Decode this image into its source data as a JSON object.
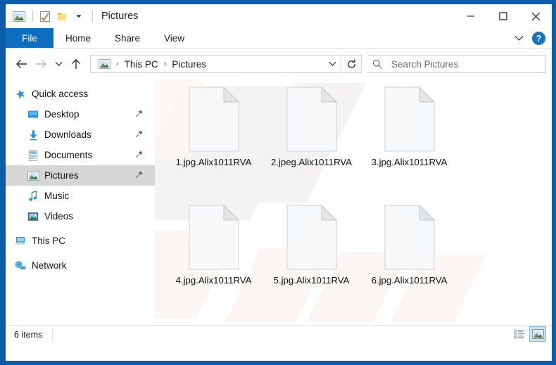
{
  "window": {
    "title": "Pictures",
    "accent_color": "#0d5ca9",
    "quick_access_icons": [
      "pictures-icon",
      "checkmark-document-icon",
      "folder-icon",
      "chevron-down-icon"
    ],
    "controls": {
      "minimize": "─",
      "maximize": "☐",
      "close": "✕"
    }
  },
  "ribbon": {
    "tabs": [
      {
        "label": "File",
        "active": true
      },
      {
        "label": "Home",
        "active": false
      },
      {
        "label": "Share",
        "active": false
      },
      {
        "label": "View",
        "active": false
      }
    ],
    "expand_icon": "chevron-down-icon",
    "help_label": "?"
  },
  "navigation": {
    "back_title": "Back",
    "forward_title": "Forward",
    "recent_title": "Recent locations",
    "up_title": "Up",
    "breadcrumb": [
      "This PC",
      "Pictures"
    ],
    "breadcrumb_separator": "›",
    "refresh_title": "Refresh"
  },
  "search": {
    "placeholder": "Search Pictures",
    "value": ""
  },
  "sidebar": {
    "items": [
      {
        "label": "Quick access",
        "icon": "star-icon",
        "root": true,
        "pinned": false,
        "selected": false
      },
      {
        "label": "Desktop",
        "icon": "desktop-icon",
        "root": false,
        "pinned": true,
        "selected": false
      },
      {
        "label": "Downloads",
        "icon": "downloads-icon",
        "root": false,
        "pinned": true,
        "selected": false
      },
      {
        "label": "Documents",
        "icon": "documents-icon",
        "root": false,
        "pinned": true,
        "selected": false
      },
      {
        "label": "Pictures",
        "icon": "pictures-icon",
        "root": false,
        "pinned": true,
        "selected": true
      },
      {
        "label": "Music",
        "icon": "music-icon",
        "root": false,
        "pinned": false,
        "selected": false
      },
      {
        "label": "Videos",
        "icon": "videos-icon",
        "root": false,
        "pinned": false,
        "selected": false
      },
      {
        "label": "This PC",
        "icon": "this-pc-icon",
        "root": true,
        "pinned": false,
        "selected": false
      },
      {
        "label": "Network",
        "icon": "network-icon",
        "root": true,
        "pinned": false,
        "selected": false
      }
    ]
  },
  "files": [
    {
      "name": "1.jpg.Alix1011RVA",
      "icon": "blank-file-icon"
    },
    {
      "name": "2.jpeg.Alix1011RVA",
      "icon": "blank-file-icon"
    },
    {
      "name": "3.jpg.Alix1011RVA",
      "icon": "blank-file-icon"
    },
    {
      "name": "4.jpg.Alix1011RVA",
      "icon": "blank-file-icon"
    },
    {
      "name": "5.jpg.Alix1011RVA",
      "icon": "blank-file-icon"
    },
    {
      "name": "6.jpg.Alix1011RVA",
      "icon": "blank-file-icon"
    }
  ],
  "statusbar": {
    "item_count": "6 items",
    "views": [
      {
        "name": "details-view",
        "active": false
      },
      {
        "name": "large-icons-view",
        "active": true
      }
    ]
  }
}
